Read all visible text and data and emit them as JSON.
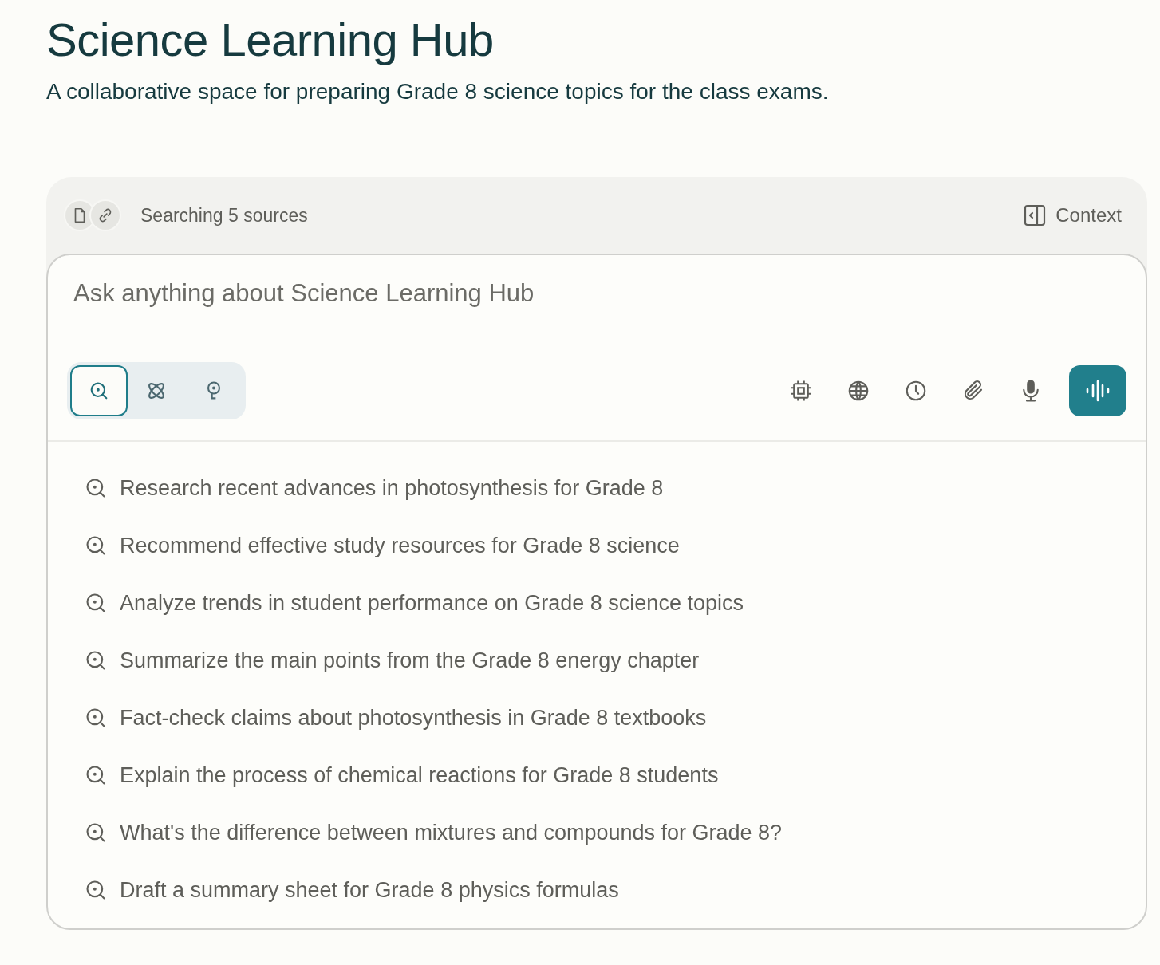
{
  "title": "Science Learning Hub",
  "description": "A collaborative space for preparing Grade 8 science topics for the class exams.",
  "sources": {
    "label": "Searching 5 sources"
  },
  "context_button": {
    "label": "Context"
  },
  "composer": {
    "placeholder": "Ask anything about Science Learning Hub"
  },
  "modes": [
    {
      "kind": "search",
      "selected": true
    },
    {
      "kind": "research",
      "selected": false
    },
    {
      "kind": "ideas",
      "selected": false
    }
  ],
  "tools": [
    {
      "kind": "chip"
    },
    {
      "kind": "globe"
    },
    {
      "kind": "clock"
    },
    {
      "kind": "paperclip"
    },
    {
      "kind": "microphone"
    }
  ],
  "suggestions": [
    "Research recent advances in photosynthesis for Grade 8",
    "Recommend effective study resources for Grade 8 science",
    "Analyze trends in student performance on Grade 8 science topics",
    "Summarize the main points from the Grade 8 energy chapter",
    "Fact-check claims about photosynthesis in Grade 8 textbooks",
    "Explain the process of chemical reactions for Grade 8 students",
    "What's the difference between mixtures and compounds for Grade 8?",
    "Draft a summary sheet for Grade 8 physics formulas"
  ]
}
